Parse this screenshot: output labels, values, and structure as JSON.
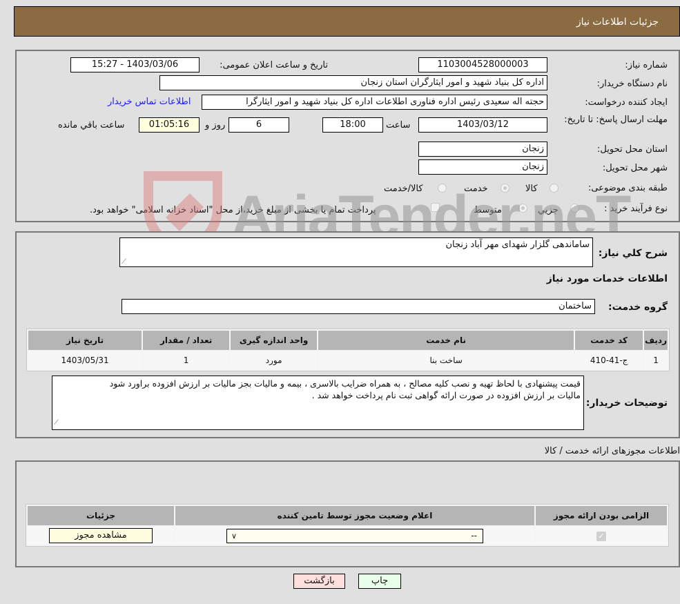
{
  "header": {
    "title": "جزئیات اطلاعات نیاز"
  },
  "details": {
    "need_number": {
      "label": "شماره نیاز:",
      "value": "1103004528000003"
    },
    "announce_datetime": {
      "label": "تاریخ و ساعت اعلان عمومی:",
      "value": "1403/03/06 - 15:27"
    },
    "buyer_org": {
      "label": "نام دستگاه خریدار:",
      "value": "اداره کل بنیاد شهید و امور ایثارگران استان زنجان"
    },
    "requester": {
      "label": "ایجاد کننده درخواست:",
      "value": "حجته اله سعیدی رئیس اداره فناوری اطلاعات  اداره کل بنیاد شهید و امور ایثارگرا"
    },
    "buyer_contact_link": "اطلاعات تماس خریدار",
    "deadline": {
      "label": "مهلت ارسال پاسخ: تا تاریخ:",
      "date": "1403/03/12",
      "time_label": "ساعت",
      "time": "18:00",
      "days": "6",
      "days_label": "روز و",
      "remaining": "01:05:16",
      "remaining_label": "ساعت باقي مانده"
    },
    "delivery_province": {
      "label": "استان محل تحویل:",
      "value": "زنجان"
    },
    "delivery_city": {
      "label": "شهر محل تحویل:",
      "value": "زنجان"
    },
    "category": {
      "label": "طبقه بندی موضوعی:",
      "options": [
        "کالا",
        "خدمت",
        "کالا/خدمت"
      ],
      "selected": "خدمت"
    },
    "purchase_process": {
      "label": "نوع فرآیند خرید :",
      "options": [
        "جزيي",
        "متوسط"
      ],
      "selected": "متوسط",
      "treasury_note": "پرداخت تمام یا بخشی از مبلغ خرید،از محل \"اسناد خزانه اسلامی\" خواهد بود."
    }
  },
  "services": {
    "description_label": "شرح کلي نیاز:",
    "description": "ساماندهی گلزار شهدای مهر آباد زنجان",
    "section_title": "اطلاعات خدمات مورد نیاز",
    "group_label": "گروه خدمت:",
    "group_value": "ساختمان",
    "table": {
      "headers": [
        "ردیف",
        "کد خدمت",
        "نام خدمت",
        "واحد اندازه گیری",
        "تعداد / مقدار",
        "تاریخ نیاز"
      ],
      "rows": [
        [
          "1",
          "ج-41-410",
          "ساخت بنا",
          "مورد",
          "1",
          "1403/05/31"
        ]
      ]
    },
    "buyer_notes_label": "توضیحات خریدار:",
    "buyer_notes": [
      "قیمت پیشنهادی با لحاظ تهیه و نصب کلیه مصالح ، به همراه ضرایب بالاسری ، بیمه  و مالیات بجز مالیات بر ارزش افزوده براورد شود",
      "مالیات بر ارزش افزوده در صورت ارائه گواهی ثبت نام پرداخت خواهد شد ."
    ]
  },
  "permits": {
    "section_title": "اطلاعات مجوزهای ارائه خدمت / کالا",
    "headers": [
      "الزامی بودن ارائه مجوز",
      "اعلام وضعیت مجوز توسط تامین کننده",
      "جزئیات"
    ],
    "row": {
      "required_checked": true,
      "status_value": "--",
      "view_button": "مشاهده مجوز"
    }
  },
  "footer": {
    "print_button": "چاپ",
    "back_button": "بازگشت"
  },
  "watermark": "AriaTender.neT",
  "colors": {
    "header_bg": "#8b6c42",
    "link": "#1a1aff",
    "print_bg": "#eaffea",
    "back_bg": "#ffdede",
    "view_bg": "#ffffe0"
  }
}
